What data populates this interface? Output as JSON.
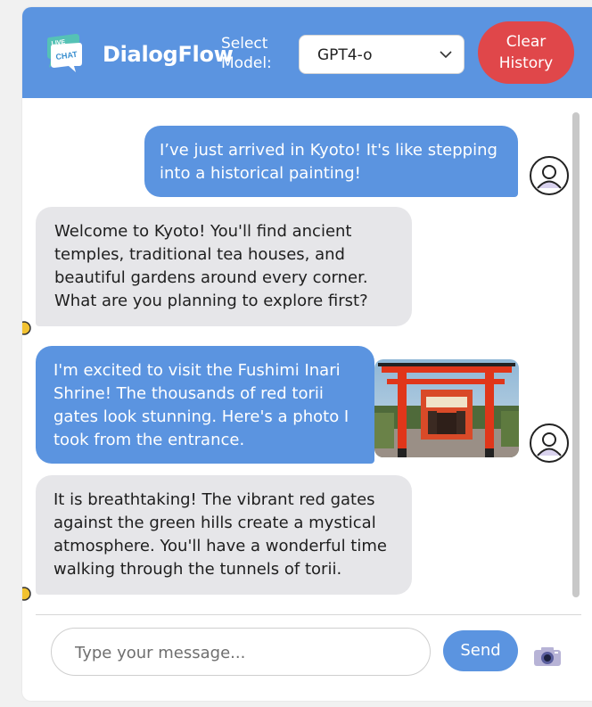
{
  "header": {
    "brand": "DialogFlow",
    "logo_text_1": "LIVE",
    "logo_text_2": "CHAT",
    "model_label_line1": "Select",
    "model_label_line2": "Model:",
    "model_selected": "GPT4-o",
    "clear_label_line1": "Clear",
    "clear_label_line2": "History"
  },
  "messages": [
    {
      "role": "user",
      "lines": [
        "I’ve just arrived in Kyoto! It's like stepping",
        "into a historical painting!"
      ]
    },
    {
      "role": "bot",
      "lines": [
        "Welcome to Kyoto! You'll find ancient",
        "temples, traditional tea houses, and",
        "beautiful gardens around every corner.",
        "What are you planning to explore first?"
      ]
    },
    {
      "role": "user",
      "lines": [
        "I'm excited to visit the Fushimi Inari",
        "Shrine! The thousands of red torii",
        "gates look stunning. Here's a photo I",
        "took from the entrance."
      ],
      "image_icon": "torii-gate-photo"
    },
    {
      "role": "bot",
      "lines": [
        "It is breathtaking! The vibrant red gates",
        "against the green hills create a mystical",
        "atmosphere. You'll have a wonderful time",
        "walking through the tunnels of torii."
      ]
    }
  ],
  "composer": {
    "placeholder": "Type your message...",
    "send_label": "Send",
    "camera_icon": "camera-icon"
  },
  "colors": {
    "accent": "#5b94e0",
    "danger": "#e0474a",
    "bot_bubble": "#e6e6e9"
  }
}
